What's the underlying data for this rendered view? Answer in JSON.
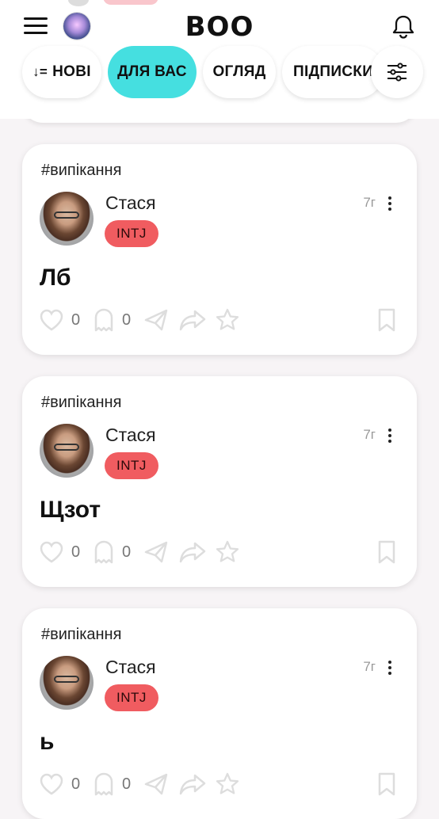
{
  "header": {
    "title": "BOO"
  },
  "tabs": [
    {
      "label": "НОВІ",
      "active": false
    },
    {
      "label": "ДЛЯ ВАС",
      "active": true
    },
    {
      "label": "ОГЛЯД",
      "active": false
    },
    {
      "label": "ПІДПИСКИ",
      "active": false
    }
  ],
  "colors": {
    "accent": "#45dfe0",
    "badge": "#f05c60"
  },
  "posts": [
    {
      "tag": "#випікання",
      "author": "Стася",
      "mbti": "INTJ",
      "time": "7г",
      "text": "Лб",
      "likes": "0",
      "comments": "0"
    },
    {
      "tag": "#випікання",
      "author": "Стася",
      "mbti": "INTJ",
      "time": "7г",
      "text": "Щзот",
      "likes": "0",
      "comments": "0"
    },
    {
      "tag": "#випікання",
      "author": "Стася",
      "mbti": "INTJ",
      "time": "7г",
      "text": "ь",
      "likes": "0",
      "comments": "0"
    }
  ]
}
